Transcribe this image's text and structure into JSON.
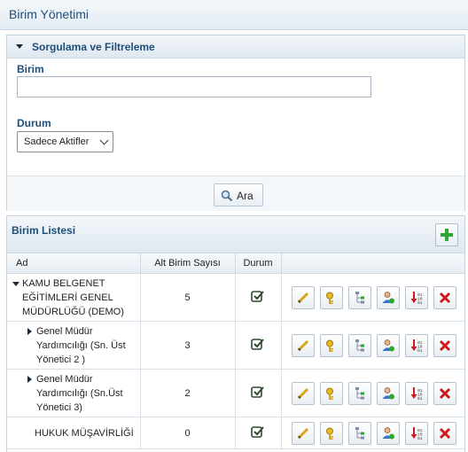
{
  "page": {
    "title": "Birim Yönetimi"
  },
  "filter": {
    "title": "Sorgulama ve Filtreleme",
    "birim_label": "Birim",
    "birim_value": "",
    "durum_label": "Durum",
    "durum_selected": "Sadece Aktifler",
    "search_label": "Ara"
  },
  "list": {
    "title": "Birim Listesi",
    "columns": {
      "name": "Ad",
      "sub_count": "Alt Birim Sayısı",
      "status": "Durum"
    },
    "rows": [
      {
        "name": "KAMU BELGENET EĞİTİMLERİ GENEL MÜDÜRLÜĞÜ (DEMO)",
        "sub_count": "5",
        "active": true,
        "expander": "expanded"
      },
      {
        "name": "Genel Müdür Yardımcılığı (Sn. Üst Yönetici 2 )",
        "sub_count": "3",
        "active": true,
        "expander": "collapsed"
      },
      {
        "name": "Genel Müdür Yardımcılığı (Sn.Üst Yönetici 3)",
        "sub_count": "2",
        "active": true,
        "expander": "collapsed"
      },
      {
        "name": "HUKUK MÜŞAVİRLİĞİ",
        "sub_count": "0",
        "active": true,
        "expander": "none"
      }
    ],
    "row_actions": [
      "edit-icon",
      "key-icon",
      "org-chart-icon",
      "user-assign-icon",
      "binary-export-icon",
      "delete-icon"
    ]
  },
  "colors": {
    "title_blue": "#1f4e79",
    "add_green": "#2ea52e",
    "delete_red": "#cc1b1b"
  }
}
